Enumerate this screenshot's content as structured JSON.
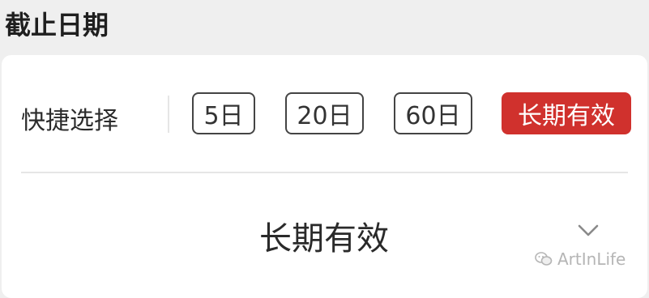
{
  "section": {
    "title": "截止日期"
  },
  "quick_select": {
    "label": "快捷选择",
    "options": [
      {
        "label": "5日",
        "selected": false
      },
      {
        "label": "20日",
        "selected": false
      },
      {
        "label": "60日",
        "selected": false
      },
      {
        "label": "长期有效",
        "selected": true
      }
    ]
  },
  "deadline_select": {
    "value": "长期有效",
    "icon": "chevron-down-icon"
  },
  "watermark": {
    "icon": "wechat-icon",
    "text": "ArtInLife"
  },
  "colors": {
    "accent": "#d0312d",
    "background": "#efefef",
    "card": "#ffffff"
  }
}
